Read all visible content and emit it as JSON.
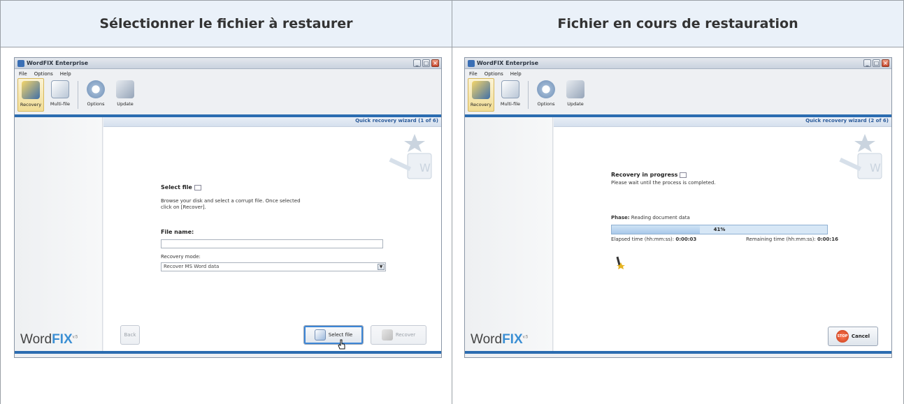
{
  "columns": [
    {
      "header": "Sélectionner le fichier à restaurer"
    },
    {
      "header": "Fichier en cours de restauration"
    }
  ],
  "app": {
    "title": "WordFIX Enterprise",
    "menu": [
      "File",
      "Options",
      "Help"
    ],
    "toolbar": [
      "Recovery",
      "Multi-file",
      "Options",
      "Update"
    ],
    "brand_word": "Word",
    "brand_fix": "FIX",
    "brand_version": "v.5"
  },
  "left": {
    "wizard_step": "Quick recovery wizard (1 of 6)",
    "heading": "Select file",
    "description": "Browse your disk and select a corrupt file. Once selected click on [Recover].",
    "file_name_label": "File name:",
    "file_name_value": "",
    "recovery_mode_label": "Recovery mode:",
    "recovery_mode_value": "Recover MS Word data",
    "back_label": "Back",
    "select_file_label": "Select file",
    "recover_label": "Recover"
  },
  "right": {
    "wizard_step": "Quick recovery wizard (2 of 6)",
    "heading": "Recovery in progress",
    "description": "Please wait until the process is completed.",
    "phase_label": "Phase:",
    "phase_value": "Reading document data",
    "progress_text": "41%",
    "progress_fraction": 0.41,
    "elapsed_label": "Elapsed time (hh:mm:ss):",
    "elapsed_value": "0:00:03",
    "remaining_label": "Remaining time (hh:mm:ss):",
    "remaining_value": "0:00:16",
    "stop_text": "STOP",
    "cancel_label": "Cancel"
  },
  "colors": {
    "accent": "#2b6cb0",
    "header_bg": "#eaf1f9",
    "toolbar_active": "#f1dd95"
  }
}
